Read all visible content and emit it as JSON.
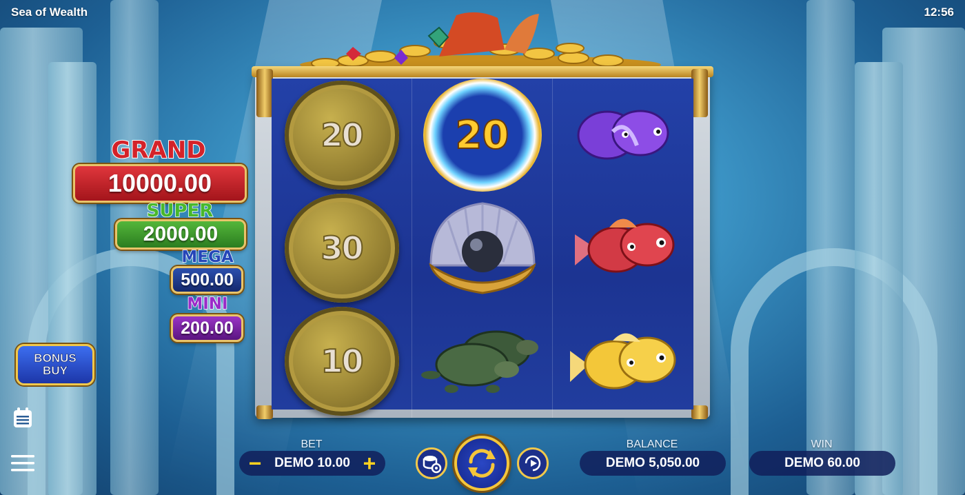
{
  "app": {
    "title": "Sea of Wealth",
    "time": "12:56"
  },
  "jackpots": [
    {
      "name": "GRAND",
      "value": "10000.00",
      "color": "#c9232b"
    },
    {
      "name": "SUPER",
      "value": "2000.00",
      "color": "#3c9d2b"
    },
    {
      "name": "MEGA",
      "value": "500.00",
      "color": "#1d3b8c"
    },
    {
      "name": "MINI",
      "value": "200.00",
      "color": "#7a1f9e"
    }
  ],
  "bonus_buy": {
    "line1": "BONUS",
    "line2": "BUY"
  },
  "reels": [
    [
      {
        "type": "coin",
        "value": "20"
      },
      {
        "type": "coin",
        "value": "30"
      },
      {
        "type": "coin",
        "value": "10"
      }
    ],
    [
      {
        "type": "glow-coin",
        "value": "20"
      },
      {
        "type": "pearl-shell",
        "value": ""
      },
      {
        "type": "turtles",
        "value": ""
      }
    ],
    [
      {
        "type": "purple-fish",
        "value": ""
      },
      {
        "type": "red-fish",
        "value": ""
      },
      {
        "type": "yellow-fish",
        "value": ""
      }
    ]
  ],
  "bottom": {
    "bet_label": "BET",
    "bet_value": "DEMO 10.00",
    "balance_label": "BALANCE",
    "balance_value": "DEMO 5,050.00",
    "win_label": "WIN",
    "win_value": "DEMO 60.00",
    "minus": "−",
    "plus": "+"
  },
  "icons": [
    "calendar-icon",
    "menu-icon",
    "coin-settings-icon",
    "spin-icon",
    "autoplay-icon"
  ]
}
